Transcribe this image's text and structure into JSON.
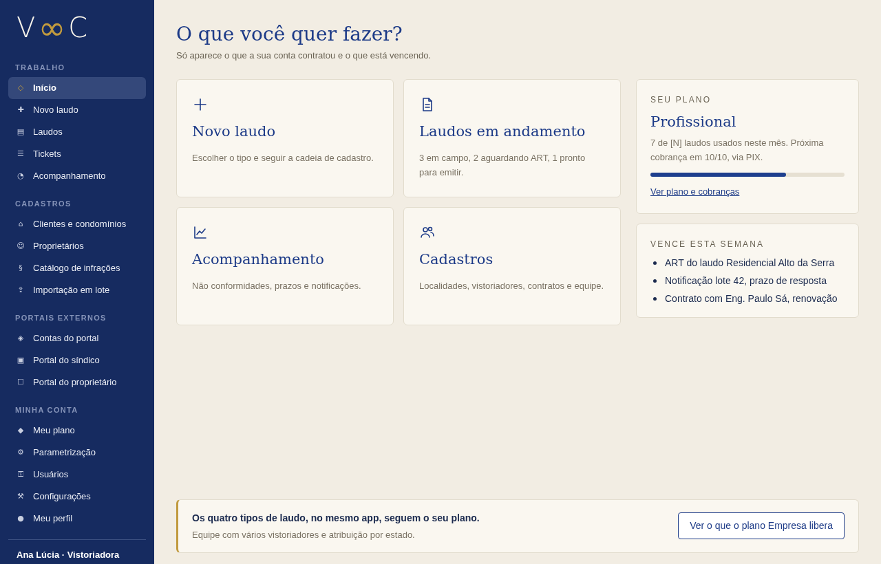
{
  "sidebar": {
    "logo": {
      "left": "V",
      "middle": "∞",
      "right": "C"
    },
    "sections": [
      {
        "title": "TRABALHO",
        "items": [
          {
            "glyph": "◇",
            "label": "Início",
            "selected": true
          },
          {
            "glyph": "✚",
            "label": "Novo laudo",
            "selected": false
          },
          {
            "glyph": "▤",
            "label": "Laudos",
            "selected": false
          },
          {
            "glyph": "☰",
            "label": "Tickets",
            "selected": false
          },
          {
            "glyph": "◔",
            "label": "Acompanhamento",
            "selected": false
          }
        ]
      },
      {
        "title": "CADASTROS",
        "items": [
          {
            "glyph": "⌂",
            "label": "Clientes e condomínios",
            "selected": false
          },
          {
            "glyph": "☺",
            "label": "Proprietários",
            "selected": false
          },
          {
            "glyph": "§",
            "label": "Catálogo de infrações",
            "selected": false
          },
          {
            "glyph": "⇪",
            "label": "Importação em lote",
            "selected": false
          }
        ]
      },
      {
        "title": "PORTAIS EXTERNOS",
        "items": [
          {
            "glyph": "◈",
            "label": "Contas do portal",
            "selected": false
          },
          {
            "glyph": "▣",
            "label": "Portal do síndico",
            "selected": false
          },
          {
            "glyph": "☐",
            "label": "Portal do proprietário",
            "selected": false
          }
        ]
      },
      {
        "title": "MINHA CONTA",
        "items": [
          {
            "glyph": "◆",
            "label": "Meu plano",
            "selected": false
          },
          {
            "glyph": "⚙",
            "label": "Parametrização",
            "selected": false
          },
          {
            "glyph": "⚿",
            "label": "Usuários",
            "selected": false
          },
          {
            "glyph": "⚒",
            "label": "Configurações",
            "selected": false
          },
          {
            "glyph": "●",
            "label": "Meu perfil",
            "selected": false
          }
        ]
      }
    ],
    "user": "Ana Lúcia · Vistoriadora"
  },
  "heading": {
    "title": "O que você quer fazer?",
    "subtitle": "Só aparece o que a sua conta contratou e o que está vencendo."
  },
  "actions": [
    {
      "kind": "plus",
      "title": "Novo laudo",
      "description": "Escolher o tipo e seguir a cadeia de cadastro."
    },
    {
      "kind": "document",
      "title": "Laudos em andamento",
      "description": "3 em campo, 2 aguardando ART, 1 pronto para emitir."
    },
    {
      "kind": "chart",
      "title": "Acompanhamento",
      "description": "Não conformidades, prazos e notificações."
    },
    {
      "kind": "people",
      "title": "Cadastros",
      "description": "Localidades, vistoriadores, contratos e equipe."
    }
  ],
  "plan": {
    "label": "SEU PLANO",
    "name": "Profissional",
    "usage": "7 de [N] laudos usados neste mês. Próxima cobrança em 10/10, via PIX.",
    "level": 0.7,
    "link": "Ver plano e cobranças"
  },
  "due": {
    "label": "VENCE ESTA SEMANA",
    "items": [
      "ART do laudo Residencial Alto da Serra",
      "Notificação lote 42, prazo de resposta",
      "Contrato com Eng. Paulo Sá, renovação"
    ]
  },
  "banner": {
    "title": "Os quatro tipos de laudo, no mesmo app, seguem o seu plano.",
    "text": "Equipe com vários vistoriadores e atribuição por estado.",
    "button": "Ver o que o plano Empresa libera"
  }
}
